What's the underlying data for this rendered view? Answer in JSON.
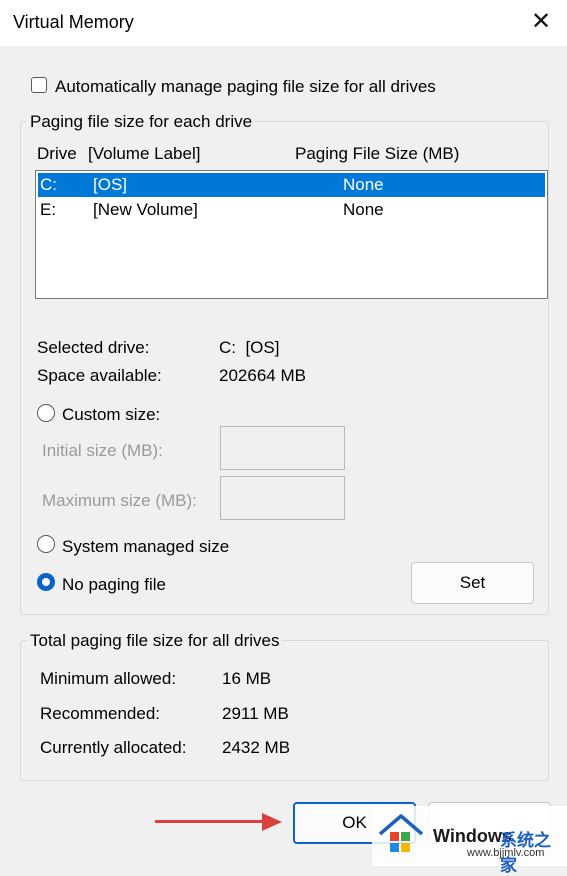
{
  "window": {
    "title": "Virtual Memory"
  },
  "auto_manage": {
    "label": "Automatically manage paging file size for all drives",
    "checked": false
  },
  "per_drive": {
    "group_label": "Paging file size for each drive",
    "headers": {
      "drive": "Drive",
      "volume": "[Volume Label]",
      "size": "Paging File Size (MB)"
    },
    "rows": [
      {
        "drive": "C:",
        "label": "[OS]",
        "size": "None",
        "selected": true
      },
      {
        "drive": "E:",
        "label": "[New Volume]",
        "size": "None",
        "selected": false
      }
    ],
    "selected_drive_label": "Selected drive:",
    "selected_drive_value": "C:  [OS]",
    "space_available_label": "Space available:",
    "space_available_value": "202664 MB",
    "custom_size_label": "Custom size:",
    "initial_size_label": "Initial size (MB):",
    "maximum_size_label": "Maximum size (MB):",
    "system_managed_label": "System managed size",
    "no_paging_label": "No paging file",
    "set_label": "Set"
  },
  "totals": {
    "group_label": "Total paging file size for all drives",
    "minimum_label": "Minimum allowed:",
    "minimum_value": "16 MB",
    "recommended_label": "Recommended:",
    "recommended_value": "2911 MB",
    "allocated_label": "Currently allocated:",
    "allocated_value": "2432 MB"
  },
  "footer": {
    "ok_label": "OK"
  },
  "watermark": {
    "brand": "Windows",
    "brand_cn": "系统之家",
    "url": "www.bjjmlv.com"
  },
  "colors": {
    "accent": "#0078d7",
    "arrow": "#d8413c"
  }
}
